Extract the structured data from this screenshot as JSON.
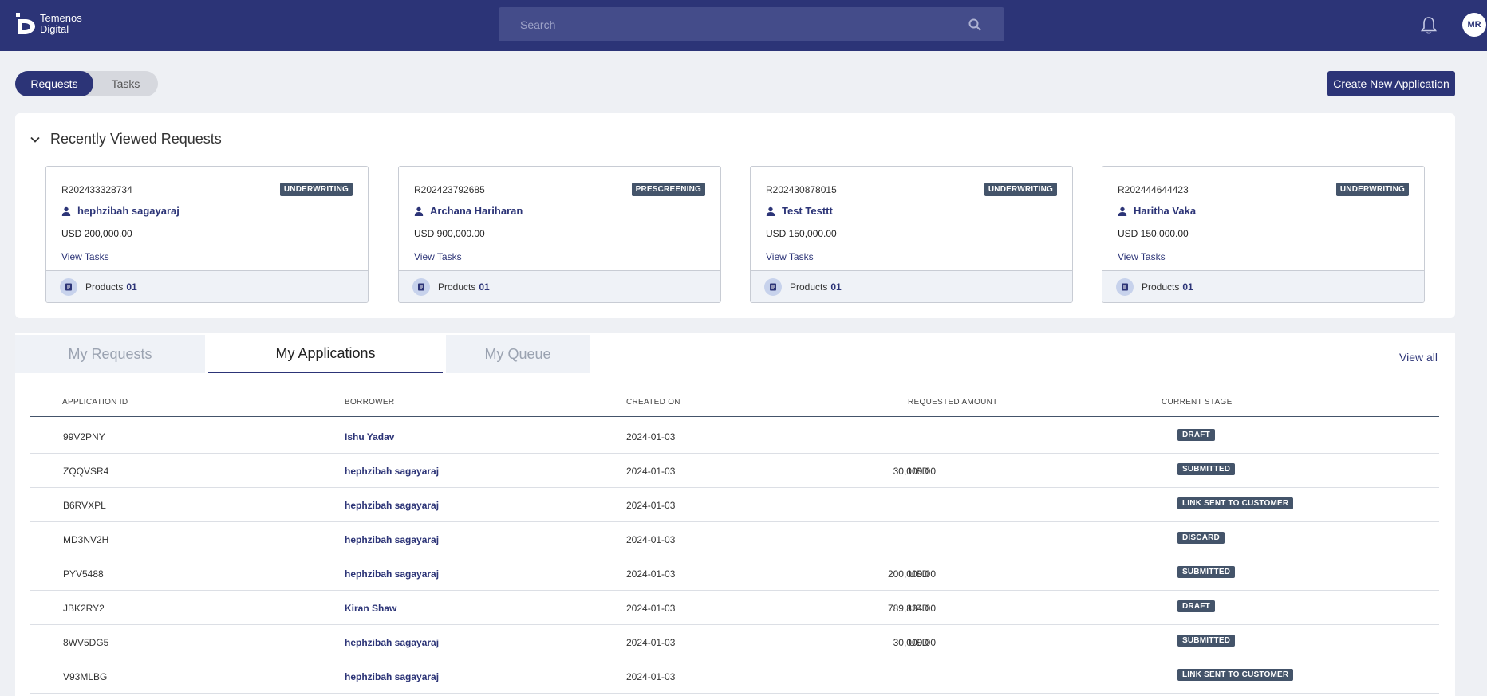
{
  "brand": {
    "line1": "Temenos",
    "line2": "Digital"
  },
  "search": {
    "placeholder": "Search"
  },
  "user": {
    "initials": "MR"
  },
  "toggle": {
    "active": "Requests",
    "inactive": "Tasks"
  },
  "create_button": "Create New Application",
  "recent": {
    "title": "Recently Viewed Requests",
    "cards": [
      {
        "id": "R202433328734",
        "stage": "UNDERWRITING",
        "borrower": "hephzibah sagayaraj",
        "amount": "USD 200,000.00",
        "view_tasks": "View Tasks",
        "products_label": "Products",
        "products_count": "01"
      },
      {
        "id": "R202423792685",
        "stage": "PRESCREENING",
        "borrower": "Archana Hariharan",
        "amount": "USD 900,000.00",
        "view_tasks": "View Tasks",
        "products_label": "Products",
        "products_count": "01"
      },
      {
        "id": "R202430878015",
        "stage": "UNDERWRITING",
        "borrower": "Test Testtt",
        "amount": "USD 150,000.00",
        "view_tasks": "View Tasks",
        "products_label": "Products",
        "products_count": "01"
      },
      {
        "id": "R202444644423",
        "stage": "UNDERWRITING",
        "borrower": "Haritha Vaka",
        "amount": "USD 150,000.00",
        "view_tasks": "View Tasks",
        "products_label": "Products",
        "products_count": "01"
      }
    ]
  },
  "tabs": [
    "My Requests",
    "My Applications",
    "My Queue"
  ],
  "view_all": "View all",
  "table": {
    "headers": [
      "APPLICATION ID",
      "BORROWER",
      "CREATED ON",
      "REQUESTED AMOUNT",
      "CURRENT STAGE"
    ],
    "rows": [
      {
        "id": "99V2PNY",
        "borrower": "Ishu Yadav",
        "created": "2024-01-03",
        "currency": "",
        "amount": "",
        "stage": "DRAFT"
      },
      {
        "id": "ZQQVSR4",
        "borrower": "hephzibah sagayaraj",
        "created": "2024-01-03",
        "currency": "USD",
        "amount": "30,000.00",
        "stage": "SUBMITTED"
      },
      {
        "id": "B6RVXPL",
        "borrower": "hephzibah sagayaraj",
        "created": "2024-01-03",
        "currency": "",
        "amount": "",
        "stage": "LINK SENT TO CUSTOMER"
      },
      {
        "id": "MD3NV2H",
        "borrower": "hephzibah sagayaraj",
        "created": "2024-01-03",
        "currency": "",
        "amount": "",
        "stage": "DISCARD"
      },
      {
        "id": "PYV5488",
        "borrower": "hephzibah sagayaraj",
        "created": "2024-01-03",
        "currency": "USD",
        "amount": "200,000.00",
        "stage": "SUBMITTED"
      },
      {
        "id": "JBK2RY2",
        "borrower": "Kiran Shaw",
        "created": "2024-01-03",
        "currency": "USD",
        "amount": "789,834.00",
        "stage": "DRAFT"
      },
      {
        "id": "8WV5DG5",
        "borrower": "hephzibah sagayaraj",
        "created": "2024-01-03",
        "currency": "USD",
        "amount": "30,000.00",
        "stage": "SUBMITTED"
      },
      {
        "id": "V93MLBG",
        "borrower": "hephzibah sagayaraj",
        "created": "2024-01-03",
        "currency": "",
        "amount": "",
        "stage": "LINK SENT TO CUSTOMER"
      }
    ]
  }
}
